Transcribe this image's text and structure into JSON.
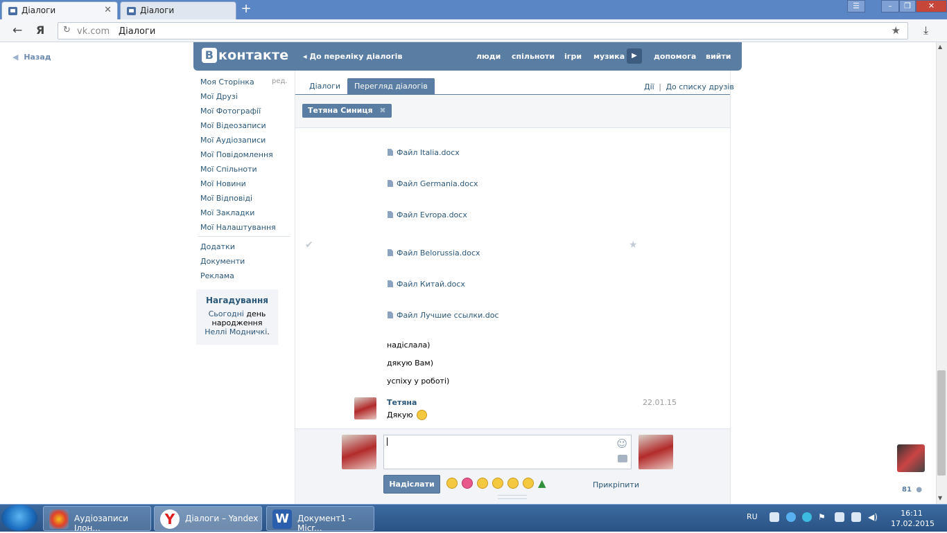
{
  "browser": {
    "tabs": [
      {
        "title": "Діалоги"
      },
      {
        "title": "Діалоги"
      }
    ],
    "address": {
      "domain": "vk.com",
      "page": "Діалоги"
    },
    "back_label": "Назад"
  },
  "header": {
    "logo": "контакте",
    "logo_letter": "В",
    "back_to_list": "До переліку діалогів",
    "nav": [
      "люди",
      "спільноти",
      "ігри",
      "музика",
      "допомога",
      "вийти"
    ]
  },
  "sidebar": {
    "items": [
      {
        "label": "Моя Сторінка",
        "edit": "ред."
      },
      {
        "label": "Мої Друзі"
      },
      {
        "label": "Мої Фотографії"
      },
      {
        "label": "Мої Відеозаписи"
      },
      {
        "label": "Мої Аудіозаписи"
      },
      {
        "label": "Мої Повідомлення"
      },
      {
        "label": "Мої Спільноти"
      },
      {
        "label": "Мої Новини"
      },
      {
        "label": "Мої Відповіді"
      },
      {
        "label": "Мої Закладки"
      },
      {
        "label": "Мої Налаштування"
      }
    ],
    "extra": [
      "Додатки",
      "Документи",
      "Реклама"
    ],
    "reminder": {
      "title": "Нагадування",
      "text_a": "Сьогодні",
      "text_b": "день народження",
      "name": "Неллі Модничкі",
      "dot": "."
    }
  },
  "dialogs": {
    "tabs": [
      "Діалоги",
      "Перегляд діалогів"
    ],
    "actions": "Дії",
    "separator": "|",
    "to_friends": "До списку друзів",
    "participant": "Тетяна Синиця",
    "files": [
      "Файл Italia.docx",
      "Файл Germania.docx",
      "Файл Evropa.docx",
      "Файл Belorussia.docx",
      "Файл Китай.docx",
      "Файл Лучшие ссылки.doc"
    ],
    "lines": [
      "надіслала)",
      "дякую Вам)",
      "успіху у роботі)"
    ],
    "last": {
      "sender": "Тетяна",
      "date": "22.01.15",
      "text": "Дякую"
    }
  },
  "composer": {
    "send": "Надіслати",
    "attach": "Прикріпити"
  },
  "right": {
    "online_count": "81"
  },
  "taskbar": {
    "tasks": [
      "Аудіозаписи Ілон...",
      "Діалоги – Yandex",
      "Документ1 - Micr..."
    ],
    "lang": "RU",
    "time": "16:11",
    "date": "17.02.2015"
  }
}
